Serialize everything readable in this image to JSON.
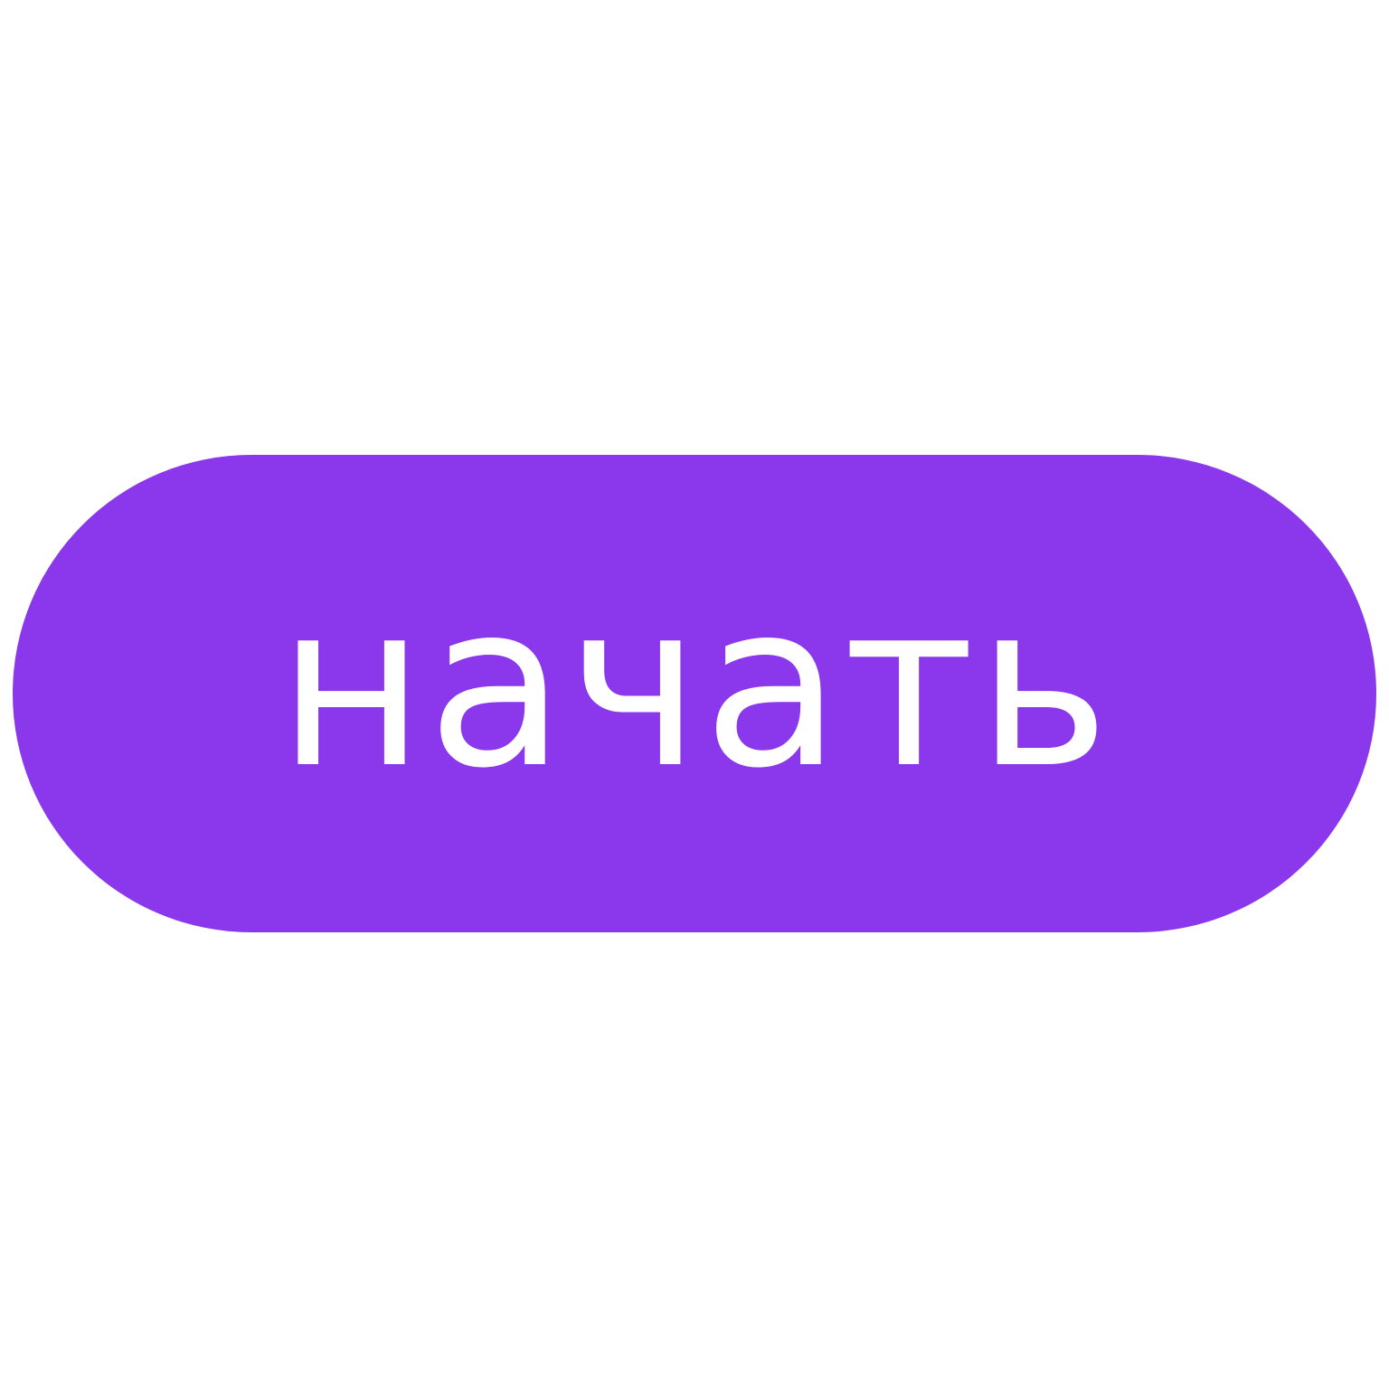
{
  "button": {
    "label": "начать",
    "background_color": "#8b38ed",
    "text_color": "#ffffff"
  },
  "page": {
    "background_color": "#ffffff"
  }
}
